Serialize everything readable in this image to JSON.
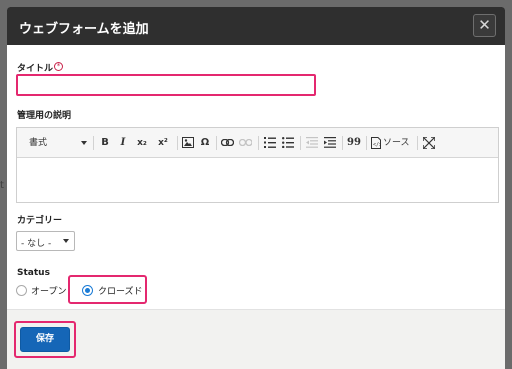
{
  "modal": {
    "title": "ウェブフォームを追加",
    "close_glyph": "✕"
  },
  "form": {
    "title_label": "タイトル",
    "title_required_glyph": "*",
    "title_value": "",
    "description_label": "管理用の説明",
    "category_label": "カテゴリー",
    "category_selected": "- なし -",
    "status_label": "Status",
    "status_options": [
      {
        "label": "オープン",
        "checked": false
      },
      {
        "label": "クローズド",
        "checked": true
      }
    ]
  },
  "editor_toolbar": {
    "format_label": "書式",
    "bold": "B",
    "italic": "I",
    "subscript": "x₂",
    "superscript": "x²",
    "special_char": "Ω",
    "blockquote": "99",
    "source_label": "ソース"
  },
  "footer": {
    "save_label": "保存"
  },
  "colors": {
    "highlight": "#e4286f",
    "primary_button": "#1566b7",
    "header_bg": "#2f2f2f"
  }
}
